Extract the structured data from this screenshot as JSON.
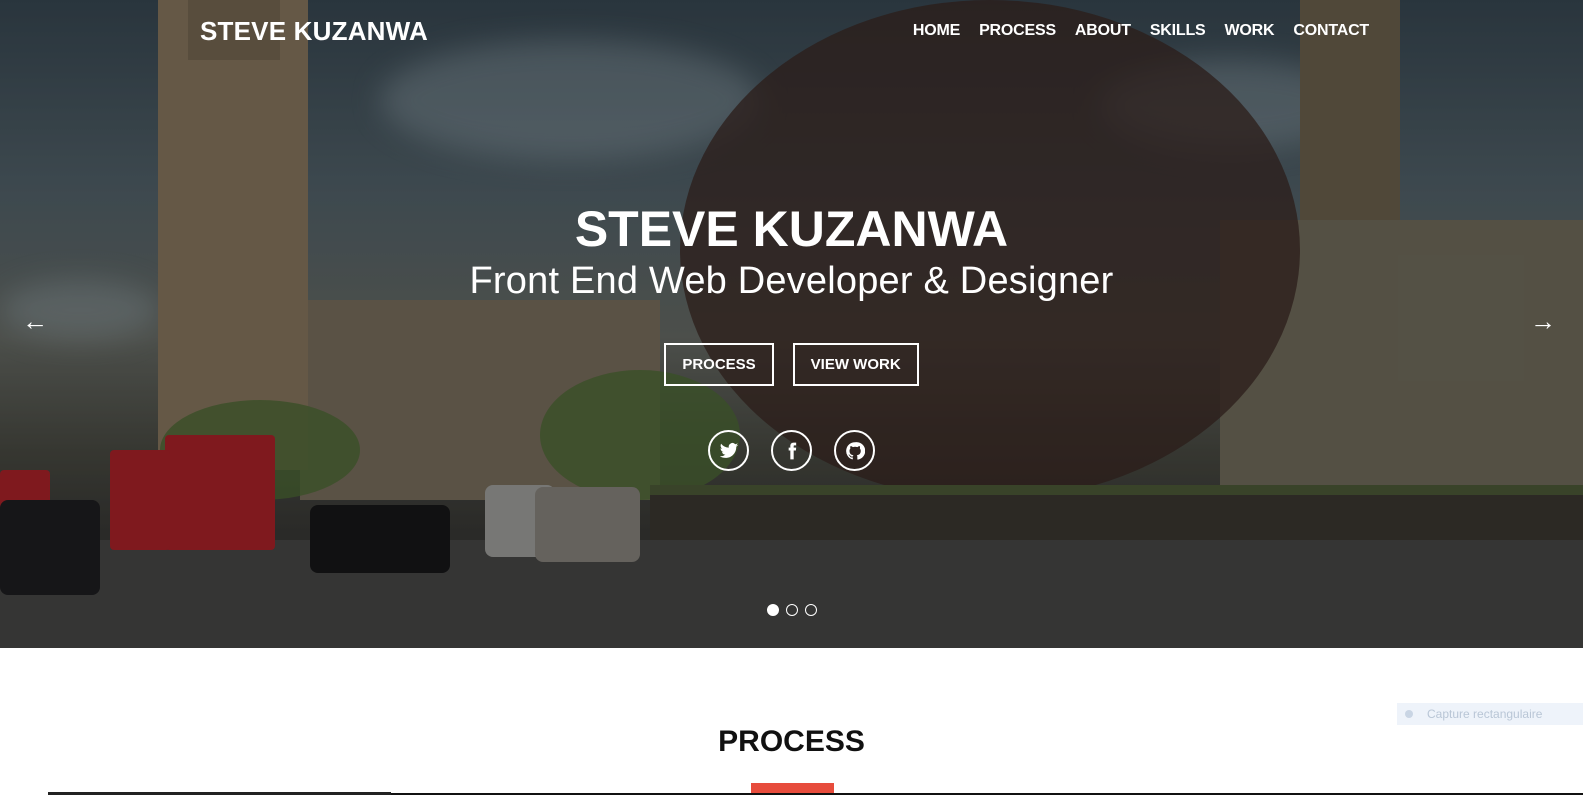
{
  "brand": {
    "name": "STEVE KUZANWA"
  },
  "nav": {
    "items": [
      {
        "label": "HOME"
      },
      {
        "label": "PROCESS"
      },
      {
        "label": "ABOUT"
      },
      {
        "label": "SKILLS"
      },
      {
        "label": "WORK"
      },
      {
        "label": "CONTACT"
      }
    ]
  },
  "hero": {
    "title": "STEVE KUZANWA",
    "subtitle": "Front End Web Developer & Designer",
    "buttons": {
      "process_label": "PROCESS",
      "view_work_label": "VIEW WORK"
    },
    "socials": [
      {
        "icon": "twitter-icon"
      },
      {
        "icon": "facebook-icon"
      },
      {
        "icon": "github-icon"
      }
    ],
    "carousel": {
      "prev_arrow": "←",
      "next_arrow": "→",
      "slide_count": 3,
      "active_index": 0
    }
  },
  "process_section": {
    "title": "PROCESS",
    "accent_color": "#e74c3c"
  },
  "overlay_badge": {
    "label": "Capture rectangulaire"
  }
}
